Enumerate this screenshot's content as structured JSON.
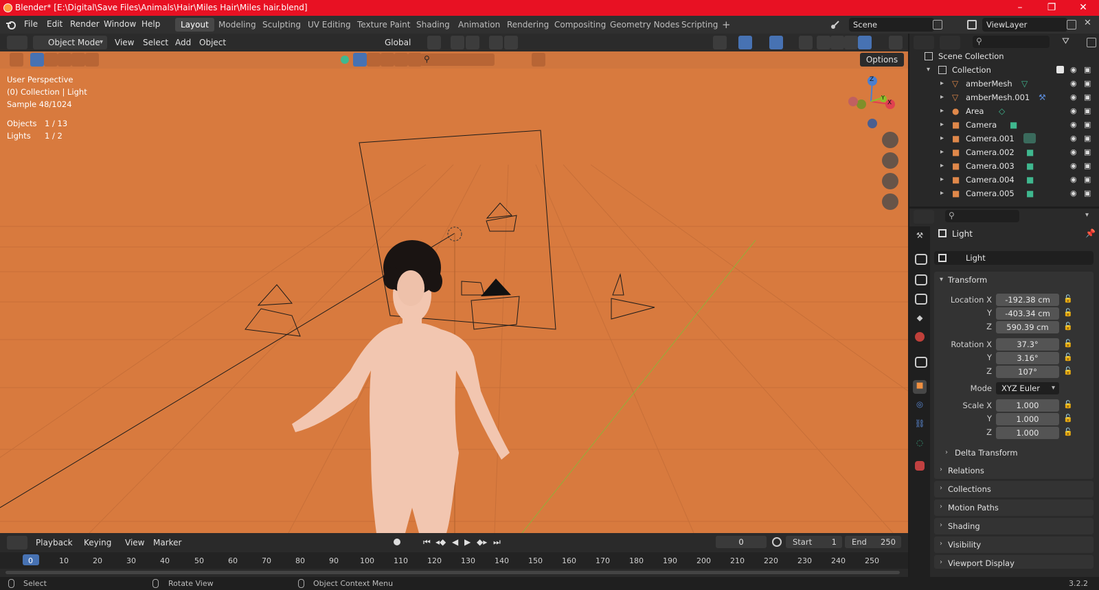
{
  "window": {
    "title": "Blender* [E:\\Digital\\Save Files\\Animals\\Hair\\Miles Hair\\Miles hair.blend]",
    "controls": [
      "–",
      "❐",
      "✕"
    ]
  },
  "menus": [
    "File",
    "Edit",
    "Render",
    "Window",
    "Help"
  ],
  "workspaces": [
    "Layout",
    "Modeling",
    "Sculpting",
    "UV Editing",
    "Texture Paint",
    "Shading",
    "Animation",
    "Rendering",
    "Compositing",
    "Geometry Nodes",
    "Scripting"
  ],
  "active_workspace": "Layout",
  "scene": {
    "name": "Scene",
    "view_layer": "ViewLayer"
  },
  "viewport_header": {
    "mode": "Object Mode",
    "menus": [
      "View",
      "Select",
      "Add",
      "Object"
    ],
    "orientation": "Global",
    "options_label": "Options"
  },
  "overlay_info": {
    "perspective": "User Perspective",
    "collection": "(0) Collection | Light",
    "sample": "Sample 48/1024",
    "objects_label": "Objects",
    "objects_value": "1 / 13",
    "lights_label": "Lights",
    "lights_value": "1 / 2"
  },
  "gizmo_axes": {
    "z": "Z",
    "y": "Y",
    "x": "X"
  },
  "outliner": {
    "scene_collection": "Scene Collection",
    "collection": "Collection",
    "items": [
      {
        "name": "amberMesh",
        "type": "mesh"
      },
      {
        "name": "amberMesh.001",
        "type": "mesh"
      },
      {
        "name": "Area",
        "type": "light"
      },
      {
        "name": "Camera",
        "type": "camera"
      },
      {
        "name": "Camera.001",
        "type": "camera"
      },
      {
        "name": "Camera.002",
        "type": "camera"
      },
      {
        "name": "Camera.003",
        "type": "camera"
      },
      {
        "name": "Camera.004",
        "type": "camera"
      },
      {
        "name": "Camera.005",
        "type": "camera"
      }
    ]
  },
  "properties": {
    "context_title": "Light",
    "object_name": "Light",
    "transform_label": "Transform",
    "location": {
      "label_x": "Location X",
      "x": "-192.38 cm",
      "y": "-403.34 cm",
      "z": "590.39 cm"
    },
    "rotation": {
      "label_x": "Rotation X",
      "x": "37.3°",
      "y": "3.16°",
      "z": "107°"
    },
    "mode_label": "Mode",
    "mode_value": "XYZ Euler",
    "scale": {
      "label_x": "Scale X",
      "x": "1.000",
      "y": "1.000",
      "z": "1.000"
    },
    "axis_y": "Y",
    "axis_z": "Z",
    "panels": [
      "Delta Transform",
      "Relations",
      "Collections",
      "Motion Paths",
      "Shading",
      "Visibility",
      "Viewport Display"
    ]
  },
  "timeline": {
    "menus": [
      "Playback",
      "Keying",
      "View",
      "Marker"
    ],
    "current_frame": "0",
    "start_label": "Start",
    "start": "1",
    "end_label": "End",
    "end": "250",
    "ticks": [
      "0",
      "10",
      "20",
      "30",
      "40",
      "50",
      "60",
      "70",
      "80",
      "90",
      "100",
      "110",
      "120",
      "130",
      "140",
      "150",
      "160",
      "170",
      "180",
      "190",
      "200",
      "210",
      "220",
      "230",
      "240",
      "250"
    ]
  },
  "statusbar": {
    "select": "Select",
    "rotate": "Rotate View",
    "context": "Object Context Menu",
    "version": "3.2.2"
  },
  "colors": {
    "titlebar": "#e81123",
    "viewport_bg": "#d87a3e",
    "accent_blue": "#4772b3",
    "camera_icon": "#e0884a",
    "data_icon_green": "#3fb88f"
  }
}
